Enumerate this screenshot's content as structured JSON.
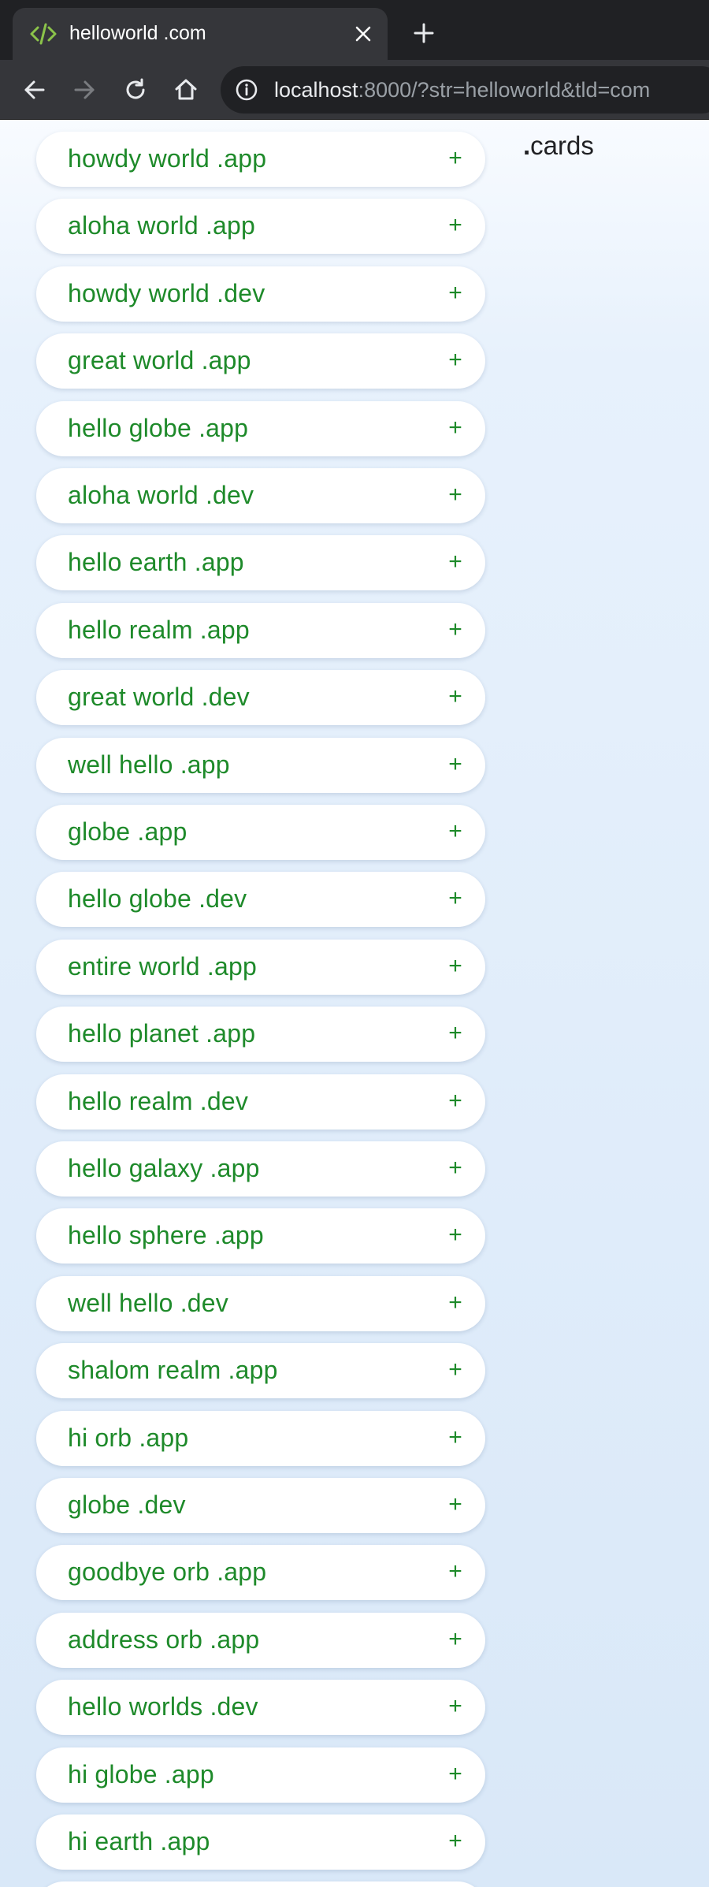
{
  "browser": {
    "tab_title": "helloworld .com",
    "new_tab_label": "+",
    "url_host": "localhost",
    "url_rest": ":8000/?str=helloworld&tld=com"
  },
  "page": {
    "cards_label_dot": ".",
    "cards_label_text": "cards",
    "add_symbol": "+",
    "domains": [
      "howdy world .app",
      "aloha world .app",
      "howdy world .dev",
      "great world .app",
      "hello globe .app",
      "aloha world .dev",
      "hello earth .app",
      "hello realm .app",
      "great world .dev",
      "well hello .app",
      "globe .app",
      "hello globe .dev",
      "entire world .app",
      "hello planet .app",
      "hello realm .dev",
      "hello galaxy .app",
      "hello sphere .app",
      "well hello .dev",
      "shalom realm .app",
      "hi orb .app",
      "globe .dev",
      "goodbye orb .app",
      "address orb .app",
      "hello worlds .dev",
      "hi globe .app",
      "hi earth .app"
    ]
  }
}
